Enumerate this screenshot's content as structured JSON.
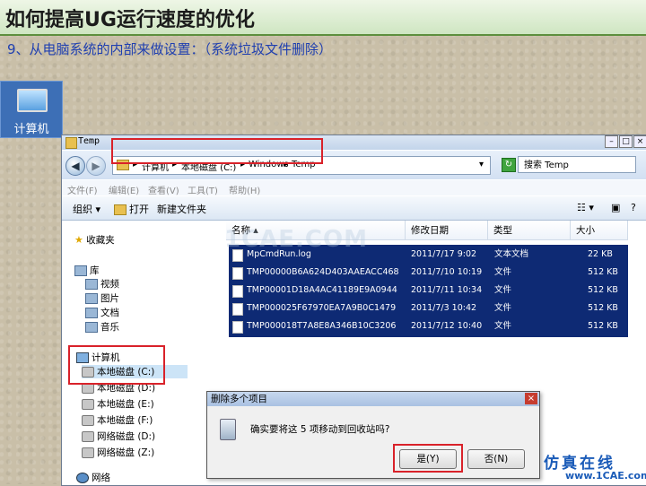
{
  "slide": {
    "title": "如何提高UG运行速度的优化",
    "subtitle": "9、从电脑系统的内部来做设置：（系统垃圾文件删除）"
  },
  "desktop": {
    "computer_label": "计算机"
  },
  "window": {
    "title": "Temp",
    "address": {
      "sep": "▸",
      "seg1": "计算机",
      "seg2": "本地磁盘 (C:)",
      "seg3": "Windows",
      "seg4": "Temp"
    },
    "search_placeholder": "搜索 Temp",
    "menu": [
      "文件(F)",
      "编辑(E)",
      "查看(V)",
      "工具(T)",
      "帮助(H)"
    ],
    "toolbar": {
      "organize": "组织 ▾",
      "open": "打开",
      "new_folder": "新建文件夹"
    },
    "nav": {
      "favorites": "收藏夹",
      "libraries": "库",
      "lib_items": [
        "视频",
        "图片",
        "文档",
        "音乐"
      ],
      "computer": "计算机",
      "drives": [
        "本地磁盘 (C:)",
        "本地磁盘 (D:)",
        "本地磁盘 (E:)",
        "本地磁盘 (F:)",
        "网络磁盘 (D:)",
        "网络磁盘 (Z:)"
      ],
      "network": "网络"
    },
    "columns": {
      "name": "名称",
      "date": "修改日期",
      "type": "类型",
      "size": "大小"
    },
    "files": [
      {
        "name": "MpCmdRun.log",
        "date": "2011/7/17 9:02",
        "type": "文本文档",
        "size": "22 KB"
      },
      {
        "name": "TMP00000B6A624D403AAEACC468",
        "date": "2011/7/10 10:19",
        "type": "文件",
        "size": "512 KB"
      },
      {
        "name": "TMP00001D18A4AC41189E9A0944",
        "date": "2011/7/11 10:34",
        "type": "文件",
        "size": "512 KB"
      },
      {
        "name": "TMP000025F67970EA7A9B0C1479",
        "date": "2011/7/3 10:42",
        "type": "文件",
        "size": "512 KB"
      },
      {
        "name": "TMP000018T7A8E8A346B10C3206",
        "date": "2011/7/12 10:40",
        "type": "文件",
        "size": "512 KB"
      }
    ],
    "watermark": "1CAE.COM"
  },
  "dialog": {
    "title": "删除多个项目",
    "message": "确实要将这 5 项移动到回收站吗?",
    "yes": "是(Y)",
    "no": "否(N)"
  },
  "logo": {
    "line1": "仿真在线",
    "line2": "www.1CAE.com"
  },
  "colors": {
    "highlight": "#d9222a",
    "selection": "#0e2a74",
    "title_bar_green": "#5d8f3d"
  }
}
